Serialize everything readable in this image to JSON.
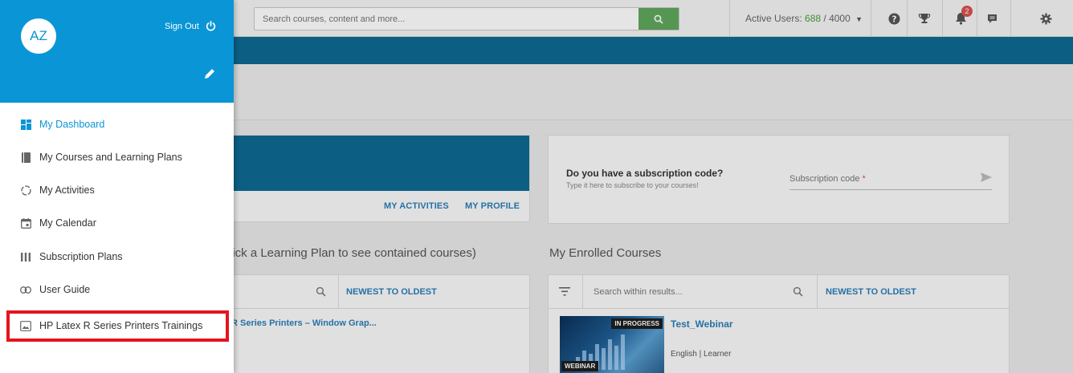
{
  "header": {
    "search_placeholder": "Search courses, content and more...",
    "active_users_label": "Active Users:",
    "active_users_count": "688",
    "active_users_total": "/ 4000",
    "notification_count": "2"
  },
  "subscription": {
    "title": "Do you have a subscription code?",
    "description": "Type it here to subscribe to your courses!",
    "field_label": "Subscription code",
    "required_mark": "*"
  },
  "left_card": {
    "link_activities": "MY ACTIVITIES",
    "link_profile": "MY PROFILE"
  },
  "learning_plans": {
    "section_title": "lick a Learning Plan to see contained courses)",
    "sort_label": "NEWEST TO OLDEST",
    "item_title": "R Series Printers – Window Grap..."
  },
  "enrolled": {
    "section_title": "My Enrolled Courses",
    "search_placeholder": "Search within results...",
    "sort_label": "NEWEST TO OLDEST",
    "course": {
      "status_tag": "IN PROGRESS",
      "type_tag": "WEBINAR",
      "title": "Test_Webinar",
      "meta": "English | Learner"
    }
  },
  "sidemenu": {
    "avatar_initials": "AZ",
    "signout_label": "Sign Out",
    "accent_color": "#0a95d6",
    "items": [
      {
        "label": "My Dashboard",
        "icon": "dashboard-icon",
        "active": true
      },
      {
        "label": "My Courses and Learning Plans",
        "icon": "book-icon"
      },
      {
        "label": "My Activities",
        "icon": "activity-circle-icon"
      },
      {
        "label": "My Calendar",
        "icon": "calendar-icon"
      },
      {
        "label": "Subscription Plans",
        "icon": "bars-icon"
      },
      {
        "label": "User Guide",
        "icon": "link-icon"
      },
      {
        "label": "HP Latex R Series Printers Trainings",
        "icon": "image-icon",
        "highlighted": true
      }
    ]
  }
}
